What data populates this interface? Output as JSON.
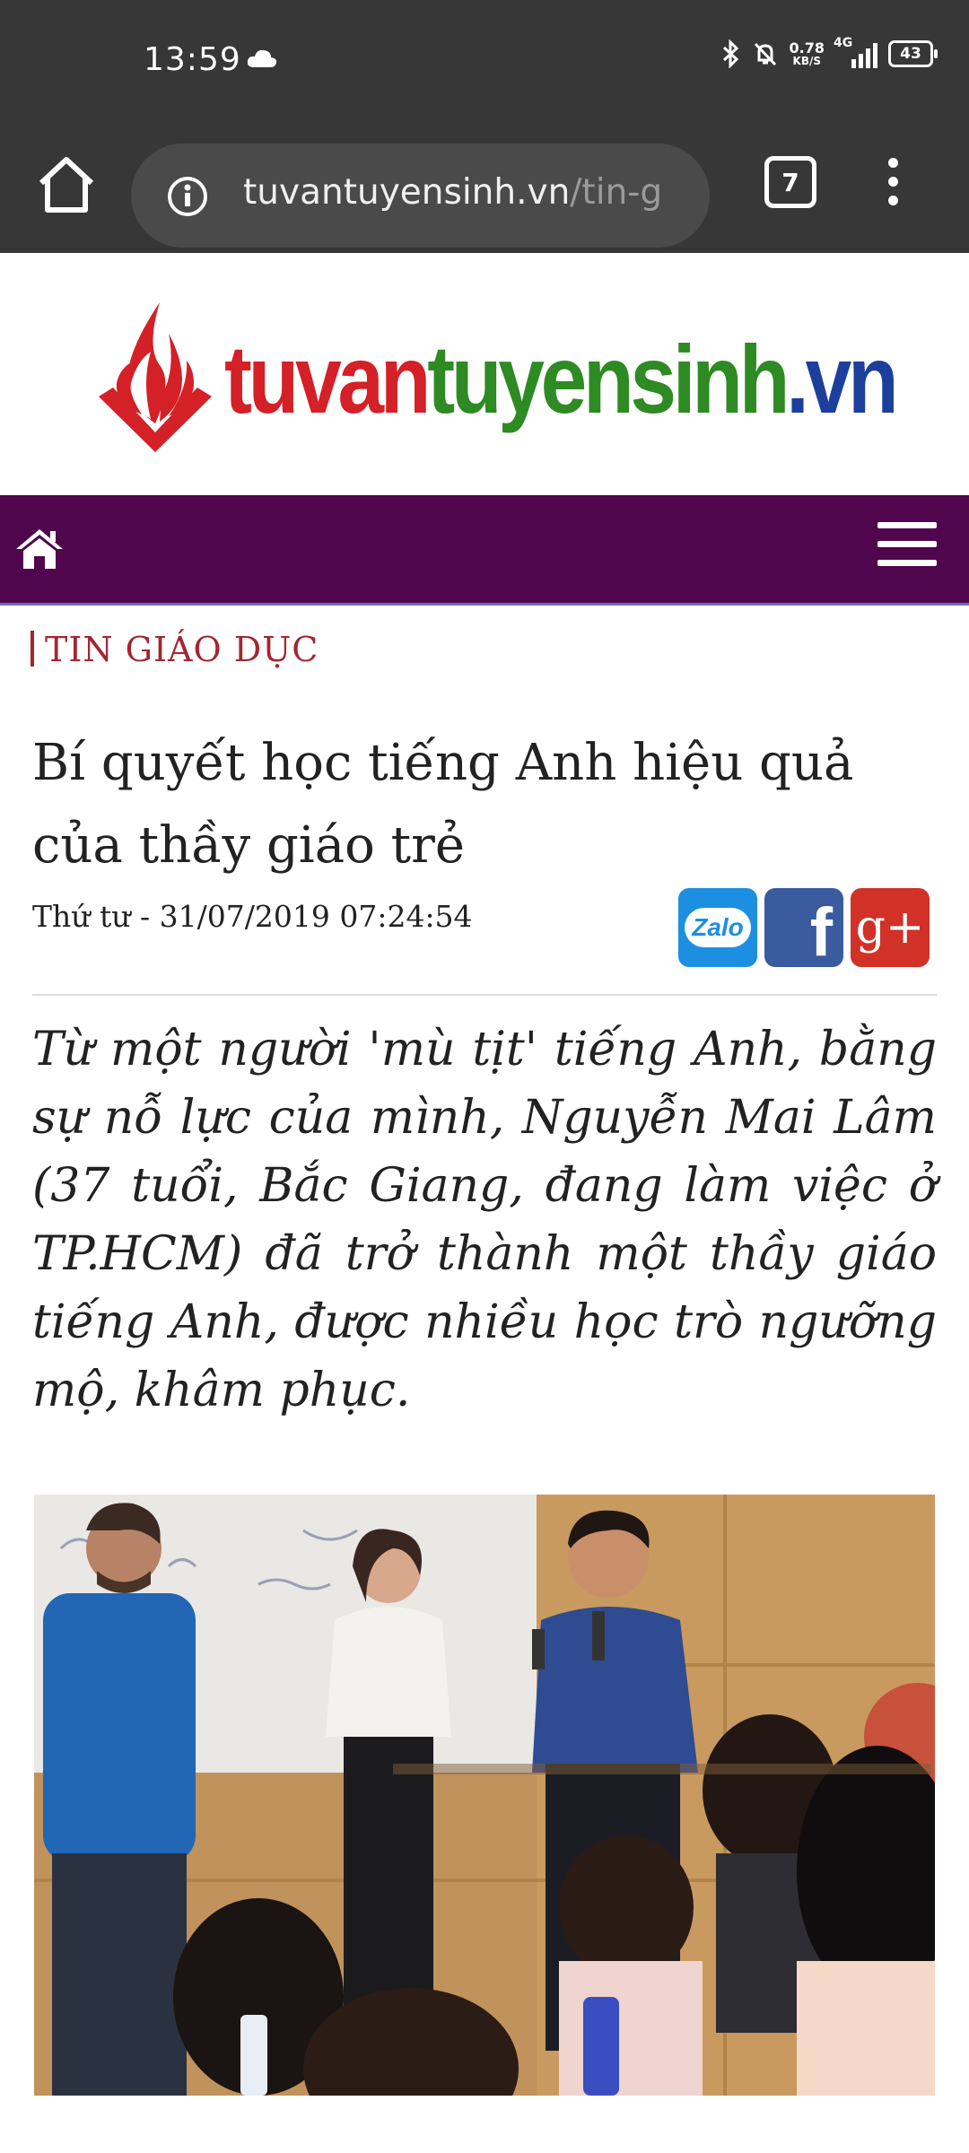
{
  "status_bar": {
    "time": "13:59",
    "net_speed_value": "0.78",
    "net_speed_unit": "KB/S",
    "network": "4G",
    "battery": "43"
  },
  "browser": {
    "url_domain": "tuvantuyensinh.vn",
    "url_path": "/tin-g",
    "tab_count": "7"
  },
  "site": {
    "logo_part1": "tuvan",
    "logo_part2": "tuyensinh",
    "logo_part3": ".vn"
  },
  "article": {
    "category": "TIN GIÁO DỤC",
    "title_line1": "Bí quyết học tiếng Anh hiệu quả",
    "title_line2": "của thầy giáo trẻ",
    "date": "Thứ tư - 31/07/2019 07:24:54",
    "lead": "Từ một người 'mù tịt' tiếng Anh, bằng sự nỗ lực của mình, Nguyễn Mai Lâm (37 tuổi, Bắc Giang, đang làm việc ở TP.HCM) đã trở thành một thầy giáo tiếng Anh, được nhiều học trò ngưỡng mộ, khâm phục."
  },
  "share": {
    "zalo": "Zalo",
    "facebook": "f",
    "google_plus": "g+"
  },
  "icons": {
    "home": "home-icon",
    "info": "info-icon",
    "menu": "more-vert-icon",
    "hamburger": "hamburger-icon"
  },
  "colors": {
    "nav_bg": "#50064d",
    "category": "#a3262f",
    "logo_red": "#d42027",
    "logo_green": "#2e8a22",
    "logo_blue": "#1c3f9c"
  }
}
